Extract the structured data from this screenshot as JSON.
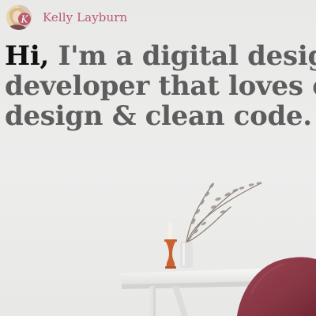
{
  "header": {
    "brand_name": "Kelly Layburn",
    "avatar_letter": "K"
  },
  "hero": {
    "greeting": "Hi,",
    "line1_rest": " I'm a digital design",
    "line2": "developer that loves el",
    "line3": "design & clean code."
  },
  "colors": {
    "brand": "#b85a6e",
    "heading": "#5d5d5d",
    "greeting": "#101010",
    "background": "#ececeb",
    "chair": "#8e3a47",
    "candlestick": "#c8622e"
  },
  "icons": {
    "avatar": "kl-monogram-avatar"
  }
}
